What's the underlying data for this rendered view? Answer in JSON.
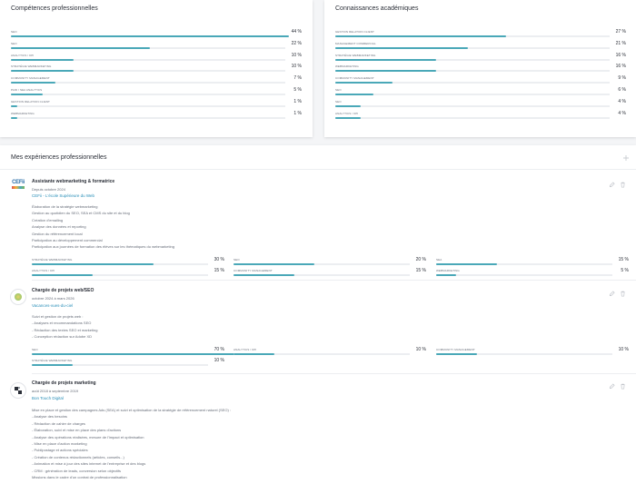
{
  "colors": {
    "accent": "#4aa8b8",
    "link": "#2a8fb8"
  },
  "competences": {
    "title": "Compétences professionnelles",
    "items": [
      {
        "name": "SEO",
        "pct": "44 %",
        "value": 0.44
      },
      {
        "name": "SEO",
        "pct": "22 %",
        "value": 0.22
      },
      {
        "name": "Analytics / KPI",
        "pct": "10 %",
        "value": 0.1
      },
      {
        "name": "Stratégie webmarketing",
        "pct": "10 %",
        "value": 0.1
      },
      {
        "name": "Community management",
        "pct": "7 %",
        "value": 0.07
      },
      {
        "name": "Paid / SEA Analytics",
        "pct": "5 %",
        "value": 0.05
      },
      {
        "name": "Gestion relation client",
        "pct": "1 %",
        "value": 0.01
      },
      {
        "name": "Webmarketing",
        "pct": "1 %",
        "value": 0.01
      }
    ]
  },
  "connaissances": {
    "title": "Connaissances académiques",
    "items": [
      {
        "name": "Gestion relation client",
        "pct": "27 %",
        "value": 0.27
      },
      {
        "name": "Management commercial",
        "pct": "21 %",
        "value": 0.21
      },
      {
        "name": "Stratégie webmarketing",
        "pct": "16 %",
        "value": 0.16
      },
      {
        "name": "Webmarketing",
        "pct": "16 %",
        "value": 0.16
      },
      {
        "name": "Community management",
        "pct": "9 %",
        "value": 0.09
      },
      {
        "name": "SEO",
        "pct": "6 %",
        "value": 0.06
      },
      {
        "name": "SEO",
        "pct": "4 %",
        "value": 0.04
      },
      {
        "name": "Analytics / KPI",
        "pct": "4 %",
        "value": 0.04
      }
    ]
  },
  "experiences": {
    "title": "Mes expériences professionnelles",
    "add_icon": "plus-icon",
    "items": [
      {
        "title": "Assistante webmarketing & formatrice",
        "date": "Depuis octobre 2024",
        "company": "CEFii - L'école Supérieure du Web",
        "logo_text": "CEFii",
        "desc": [
          "Élaboration de la stratégie webmarketing",
          "Gestion au quotidien du SEO, SEA et CMS du site et du blog",
          "Création d'emailing",
          "Analyse des données et reporting",
          "Gestion du référencement local",
          "Participation au développement commercial",
          "Participation aux journées de formation des élèves sur les thématiques du webmarketing"
        ],
        "skills": [
          {
            "name": "Stratégie webmarketing",
            "pct": "30 %",
            "value": 0.3
          },
          {
            "name": "SEO",
            "pct": "20 %",
            "value": 0.2
          },
          {
            "name": "SEA",
            "pct": "15 %",
            "value": 0.15
          },
          {
            "name": "Analytics / KPI",
            "pct": "15 %",
            "value": 0.15
          },
          {
            "name": "Community management",
            "pct": "15 %",
            "value": 0.15
          },
          {
            "name": "Webmarketing",
            "pct": "5 %",
            "value": 0.05
          }
        ]
      },
      {
        "title": "Chargée de projets web/SEO",
        "date": "octobre 2024 à mars 2026",
        "company": "Vacances-vues-du-ciel",
        "desc": [
          "Suivi et gestion de projets web :",
          "- Analyses et recommandations SEO",
          "- Rédaction des textes SEO et marketing",
          "- Conception rédaction sur Adobe XD"
        ],
        "skills": [
          {
            "name": "SEO",
            "pct": "70 %",
            "value": 0.7
          },
          {
            "name": "Analytics / KPI",
            "pct": "10 %",
            "value": 0.1
          },
          {
            "name": "Community management",
            "pct": "10 %",
            "value": 0.1
          },
          {
            "name": "Stratégie webmarketing",
            "pct": "10 %",
            "value": 0.1
          }
        ]
      },
      {
        "title": "Chargée de projets marketing",
        "date": "août 2018 à septembre 2019",
        "company": "Bon Touch Digital",
        "desc": [
          "Mise en place et gestion des campagnes Ads (SEA) et suivi et optimisation de la stratégie de référencement naturel (SEO) :",
          "- Analyse des besoins",
          "- Rédaction de cahier de charges",
          "- Élaboration, suivi et mise en place des plans d'actions",
          "- Analyse des opérations réalisées, mesure de l'impact et optimisation",
          "- Mise en place d'action marketing",
          "- Publipostage et actions spéciales",
          "- Création de contenus rédactionnels (articles, conseils...)",
          "- Animation et mise à jour des sites internet de l'entreprise et des blogs",
          "- CRM : génération de leads, conversion selon objectifs",
          "Missions dans le cadre d'un contrat de professionnalisation"
        ]
      }
    ]
  }
}
